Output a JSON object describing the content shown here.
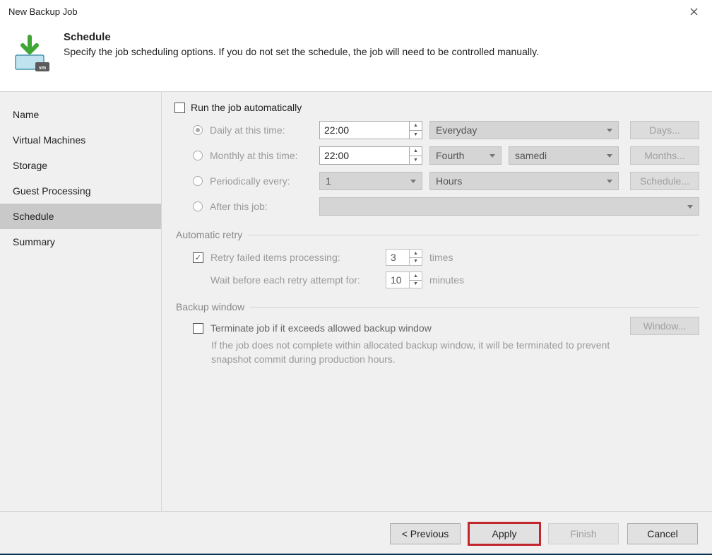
{
  "window": {
    "title": "New Backup Job"
  },
  "header": {
    "title": "Schedule",
    "subtitle": "Specify the job scheduling options. If you do not set the schedule, the job will need to be controlled manually."
  },
  "sidebar": {
    "items": [
      {
        "label": "Name"
      },
      {
        "label": "Virtual Machines"
      },
      {
        "label": "Storage"
      },
      {
        "label": "Guest Processing"
      },
      {
        "label": "Schedule",
        "active": true
      },
      {
        "label": "Summary"
      }
    ]
  },
  "schedule": {
    "run_auto_label": "Run the job automatically",
    "run_auto_checked": false,
    "daily": {
      "label": "Daily at this time:",
      "time": "22:00",
      "recurrence": "Everyday",
      "days_btn": "Days..."
    },
    "monthly": {
      "label": "Monthly at this time:",
      "time": "22:00",
      "ordinal": "Fourth",
      "weekday": "samedi",
      "months_btn": "Months..."
    },
    "periodically": {
      "label": "Periodically every:",
      "value": "1",
      "unit": "Hours",
      "schedule_btn": "Schedule..."
    },
    "after": {
      "label": "After this job:",
      "value": ""
    }
  },
  "retry": {
    "legend": "Automatic retry",
    "retry_label": "Retry failed items processing:",
    "retry_checked": true,
    "retry_count": "3",
    "times_label": "times",
    "wait_label": "Wait before each retry attempt for:",
    "wait_value": "10",
    "minutes_label": "minutes"
  },
  "backup_window": {
    "legend": "Backup window",
    "terminate_label": "Terminate job if it exceeds allowed backup window",
    "terminate_checked": false,
    "note": "If the job does not complete within allocated backup window, it will be terminated to prevent snapshot commit during production hours.",
    "window_btn": "Window..."
  },
  "footer": {
    "previous": "< Previous",
    "apply": "Apply",
    "finish": "Finish",
    "cancel": "Cancel"
  }
}
